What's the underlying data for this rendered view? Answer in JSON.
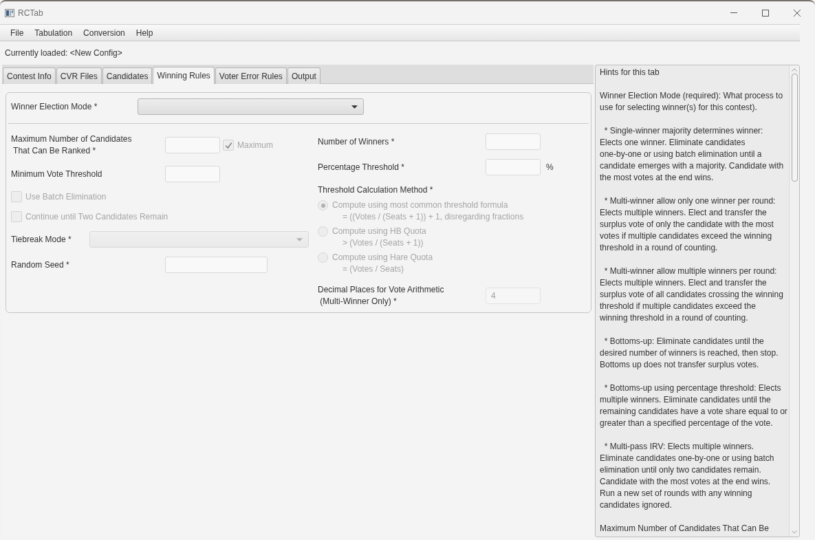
{
  "window": {
    "title": "RCTab"
  },
  "menu": [
    "File",
    "Tabulation",
    "Conversion",
    "Help"
  ],
  "status": "Currently loaded: <New Config>",
  "tabs": [
    {
      "label": "Contest Info",
      "selected": false
    },
    {
      "label": "CVR Files",
      "selected": false
    },
    {
      "label": "Candidates",
      "selected": false
    },
    {
      "label": "Winning Rules",
      "selected": true
    },
    {
      "label": "Voter Error Rules",
      "selected": false
    },
    {
      "label": "Output",
      "selected": false
    }
  ],
  "winner_mode": {
    "label": "Winner Election Mode *",
    "disabled": false
  },
  "left": [
    {
      "kind": "number",
      "label": "Maximum Number of Candidates\n That Can Be Ranked *",
      "checkbox": {
        "label": "Maximum",
        "checked": true,
        "disabled": true
      }
    },
    {
      "kind": "number",
      "label": "Minimum Vote Threshold"
    },
    {
      "kind": "checkbox",
      "label": "Use Batch Elimination",
      "checked": false,
      "disabled": true
    },
    {
      "kind": "checkbox",
      "label": "Continue until Two Candidates Remain",
      "checked": false,
      "disabled": true
    },
    {
      "kind": "dropdown",
      "label": "Tiebreak Mode *",
      "disabled": true
    },
    {
      "kind": "text",
      "label": "Random Seed *"
    }
  ],
  "right": [
    {
      "kind": "number",
      "label": "Number of Winners *"
    },
    {
      "kind": "number",
      "label": "Percentage Threshold *",
      "unit": "%"
    },
    {
      "kind": "radio_group",
      "label": "Threshold Calculation Method *",
      "disabled": false,
      "options": [
        {
          "label": "Compute using most common threshold formula",
          "formula": "= ((Votes / (Seats + 1)) + 1, disregarding fractions",
          "selected": true,
          "disabled": true
        },
        {
          "label": "Compute using HB Quota",
          "formula": "> (Votes / (Seats + 1))",
          "selected": false,
          "disabled": true
        },
        {
          "label": "Compute using Hare Quota",
          "formula": "= (Votes / Seats)",
          "selected": false,
          "disabled": true
        }
      ]
    },
    {
      "kind": "number",
      "label": "Decimal Places for Vote Arithmetic\n (Multi-Winner Only) *",
      "value": "4",
      "disabled": true
    }
  ],
  "hints": {
    "title": "Hints for this tab",
    "paragraphs": [
      "Winner Election Mode (required): What process to\nuse for selecting winner(s) for this contest).",
      "  * Single-winner majority determines winner:\nElects one winner. Eliminate candidates\none-by-one or using batch elimination until a\ncandidate emerges with a majority. Candidate with\nthe most votes at the end wins.",
      "  * Multi-winner allow only one winner per round:\nElects multiple winners. Elect and transfer the\nsurplus vote of only the candidate with the most\nvotes if multiple candidates exceed the winning\nthreshold in a round of counting.",
      "  * Multi-winner allow multiple winners per round:\nElects multiple winners. Elect and transfer the\nsurplus vote of all candidates crossing the winning\nthreshold if multiple candidates exceed the\nwinning threshold in a round of counting.",
      "  * Bottoms-up: Eliminate candidates until the\ndesired number of winners is reached, then stop.\nBottoms up does not transfer surplus votes.",
      "  * Bottoms-up using percentage threshold: Elects\nmultiple winners. Eliminate candidates until the\nremaining candidates have a vote share equal to or\ngreater than a specified percentage of the vote.",
      "  * Multi-pass IRV: Elects multiple winners.\nEliminate candidates one-by-one or using batch\nelimination until only two candidates remain.\nCandidate with the most votes at the end wins.\nRun a new set of rounds with any winning\ncandidates ignored.",
      "Maximum Number of Candidates That Can Be"
    ]
  }
}
